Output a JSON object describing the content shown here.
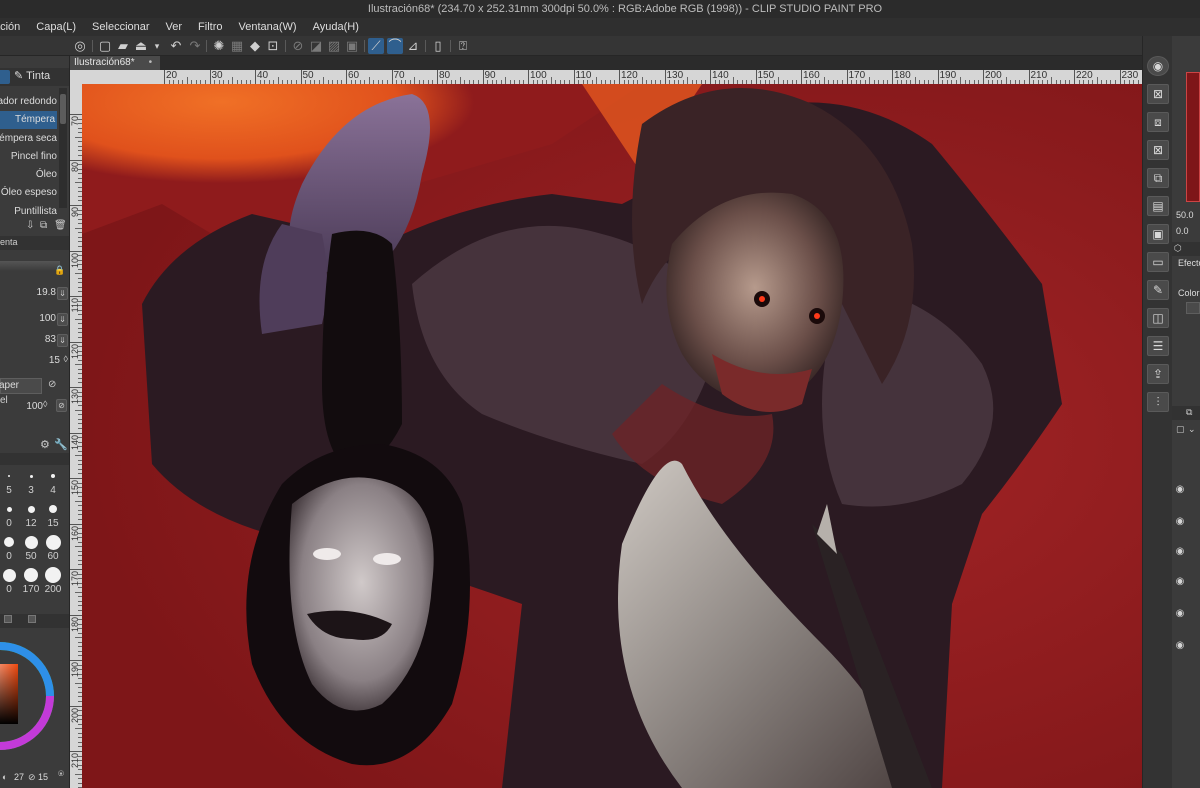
{
  "window": {
    "title": "Ilustración68* (234.70 x 252.31mm 300dpi 50.0% : RGB:Adobe RGB (1998))  - CLIP STUDIO PAINT PRO"
  },
  "menu": [
    "ación",
    "Capa(L)",
    "Seleccionar",
    "Ver",
    "Filtro",
    "Ventana(W)",
    "Ayuda(H)"
  ],
  "document_tab": {
    "label": "Ilustración68*",
    "close": "•"
  },
  "subtool": {
    "tab_label": "Tinta",
    "brushes": [
      {
        "label": "zclador redondo",
        "selected": false
      },
      {
        "label": "Témpera",
        "selected": true
      },
      {
        "label": "Témpera seca",
        "selected": false
      },
      {
        "label": "Pincel fino",
        "selected": false
      },
      {
        "label": "Óleo",
        "selected": false
      },
      {
        "label": "Óleo espeso",
        "selected": false
      },
      {
        "label": "Puntillista",
        "selected": false
      }
    ]
  },
  "tool_property": {
    "tab_label": "enta",
    "values": [
      "19.8",
      "100",
      "83",
      "15"
    ],
    "paper_label": "aper",
    "el_label": "el",
    "paper_value": "100"
  },
  "brush_sizes": {
    "rows": [
      [
        "5",
        "3",
        "4"
      ],
      [
        "0",
        "12",
        "15"
      ],
      [
        "0",
        "50",
        "60"
      ],
      [
        "0",
        "170",
        "200"
      ]
    ]
  },
  "color_readout": [
    "27",
    "15"
  ],
  "ruler": {
    "h": [
      "20",
      "30",
      "40",
      "50",
      "60",
      "70",
      "80",
      "90",
      "100",
      "110",
      "120",
      "130",
      "140",
      "150",
      "160",
      "170",
      "180",
      "190",
      "200",
      "210",
      "220",
      "230"
    ],
    "v": [
      "70",
      "80",
      "90",
      "100",
      "110",
      "120",
      "130",
      "140",
      "150",
      "160",
      "170",
      "180",
      "190",
      "200",
      "210"
    ]
  },
  "navigator": {
    "zoom": "50.0",
    "angle": "0.0"
  },
  "layer_property": {
    "title": "Efecto",
    "color_label": "Color"
  },
  "colors": {
    "accent": "#2f5f8e",
    "panel": "#3b3b3b",
    "canvas_bg": "#8f1b1c",
    "orange": "#f06a23"
  }
}
